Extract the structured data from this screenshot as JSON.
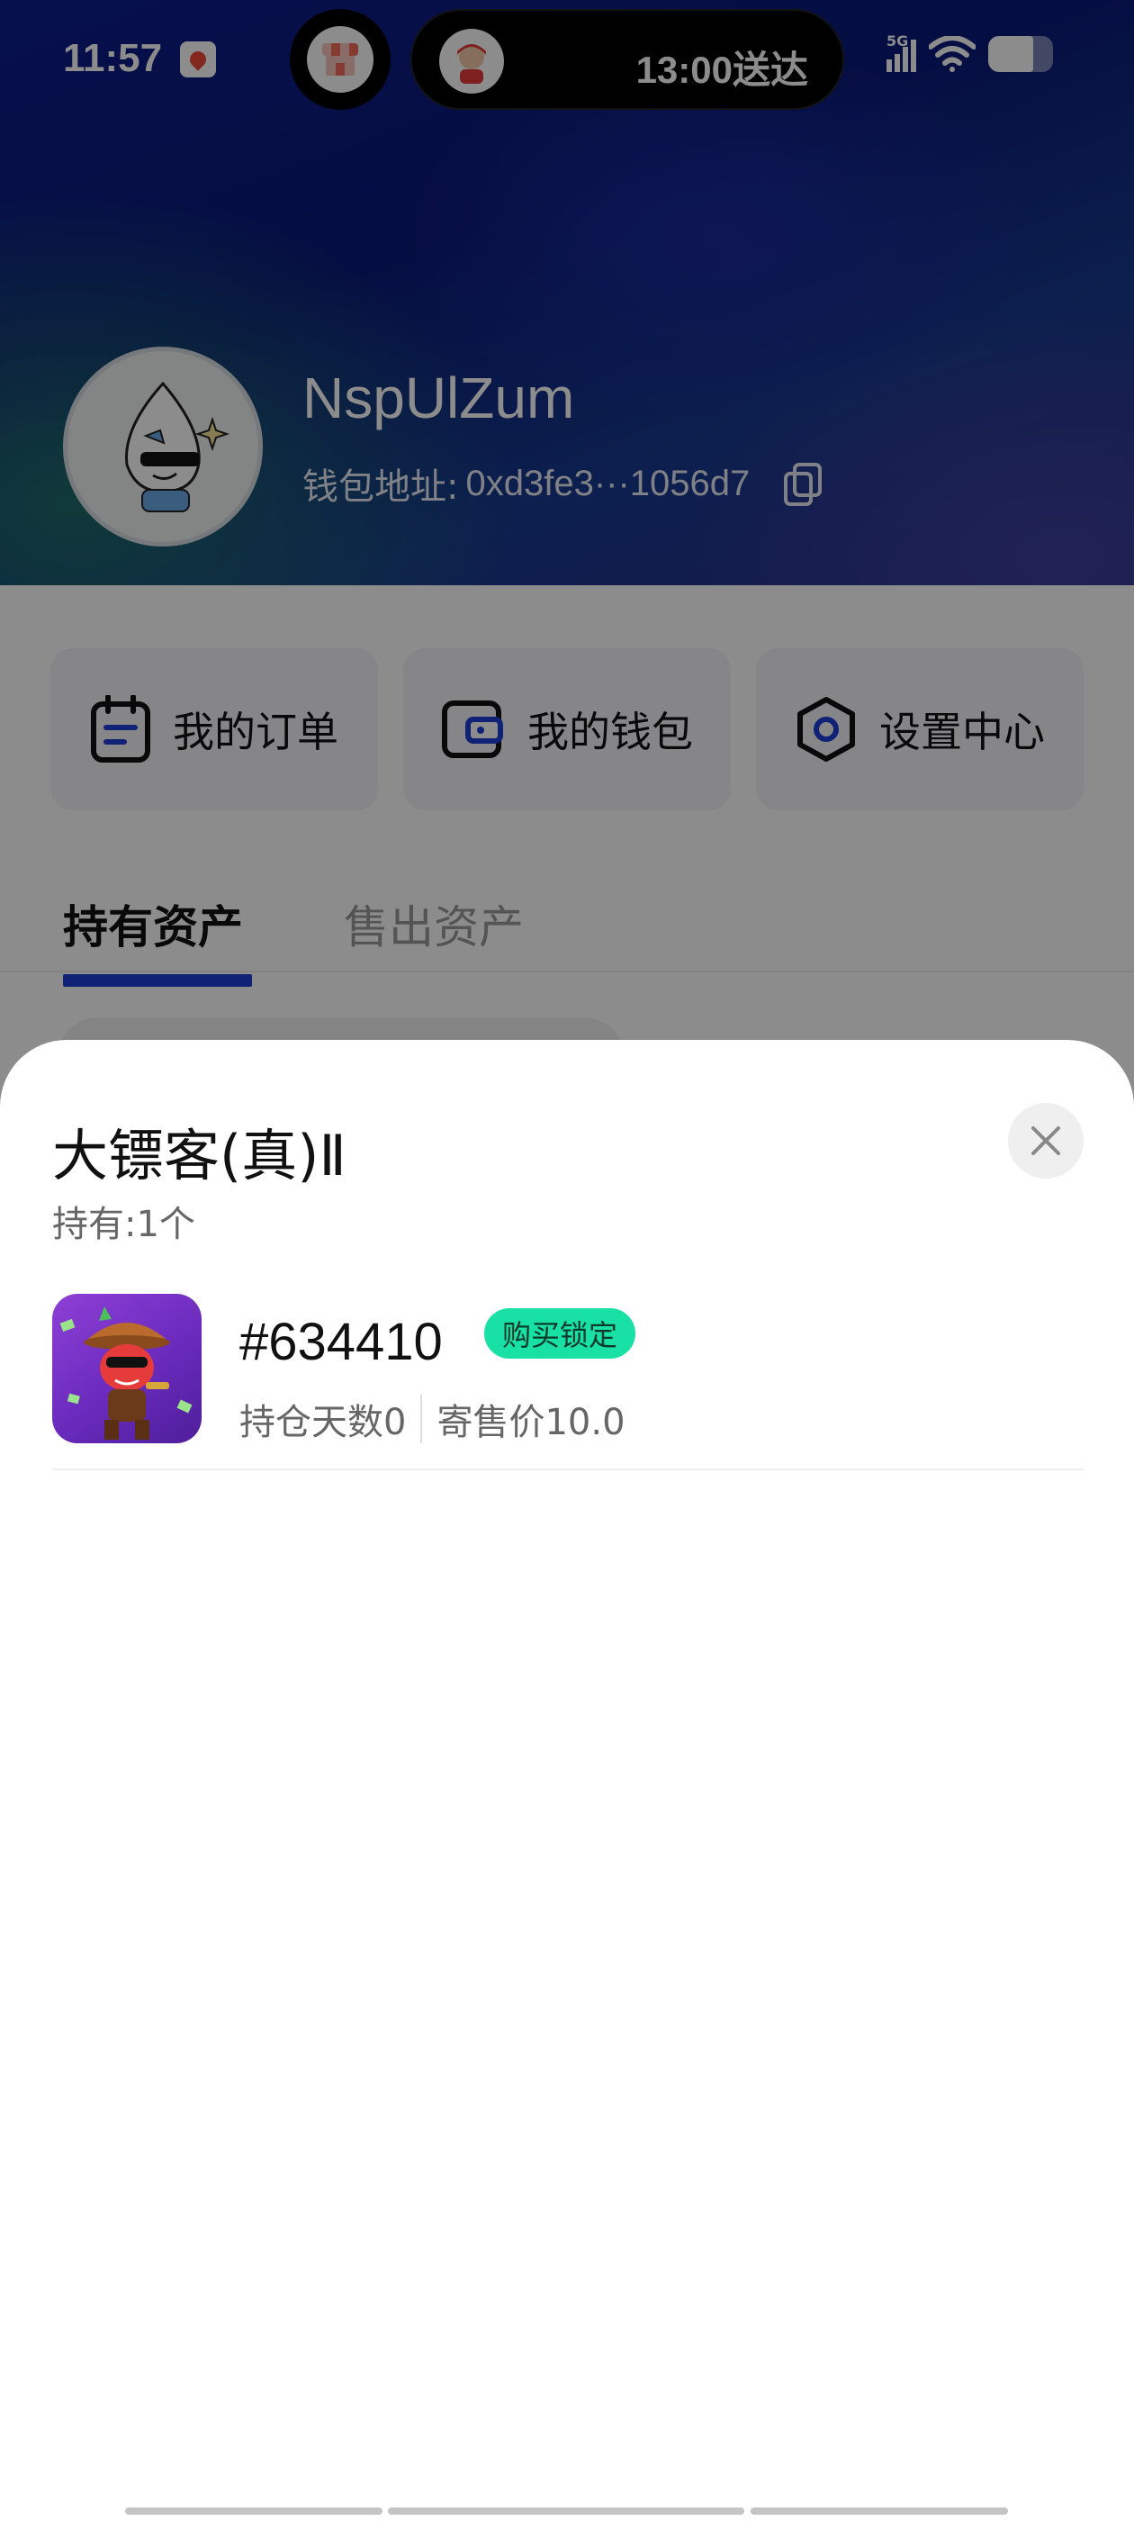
{
  "status_bar": {
    "time": "11:57",
    "island_text": "13:00送达",
    "network": "5G"
  },
  "profile": {
    "username": "NspUlZum",
    "wallet_label": "钱包地址:",
    "wallet_address": "0xd3fe3···1056d7"
  },
  "quick_actions": [
    {
      "label": "我的订单",
      "icon": "order-icon"
    },
    {
      "label": "我的钱包",
      "icon": "wallet-icon"
    },
    {
      "label": "设置中心",
      "icon": "settings-icon"
    }
  ],
  "tabs": {
    "held": "持有资产",
    "sold": "售出资产",
    "active": "held",
    "accent_color": "#1d3fd6"
  },
  "sheet": {
    "title": "大镖客(真)Ⅱ",
    "hold_count": "持有:1个",
    "items": [
      {
        "id": "#634410",
        "badge": "购买锁定",
        "badge_color": "#19e0a4",
        "days_held": "持仓天数0",
        "price": "寄售价10.0"
      }
    ]
  }
}
